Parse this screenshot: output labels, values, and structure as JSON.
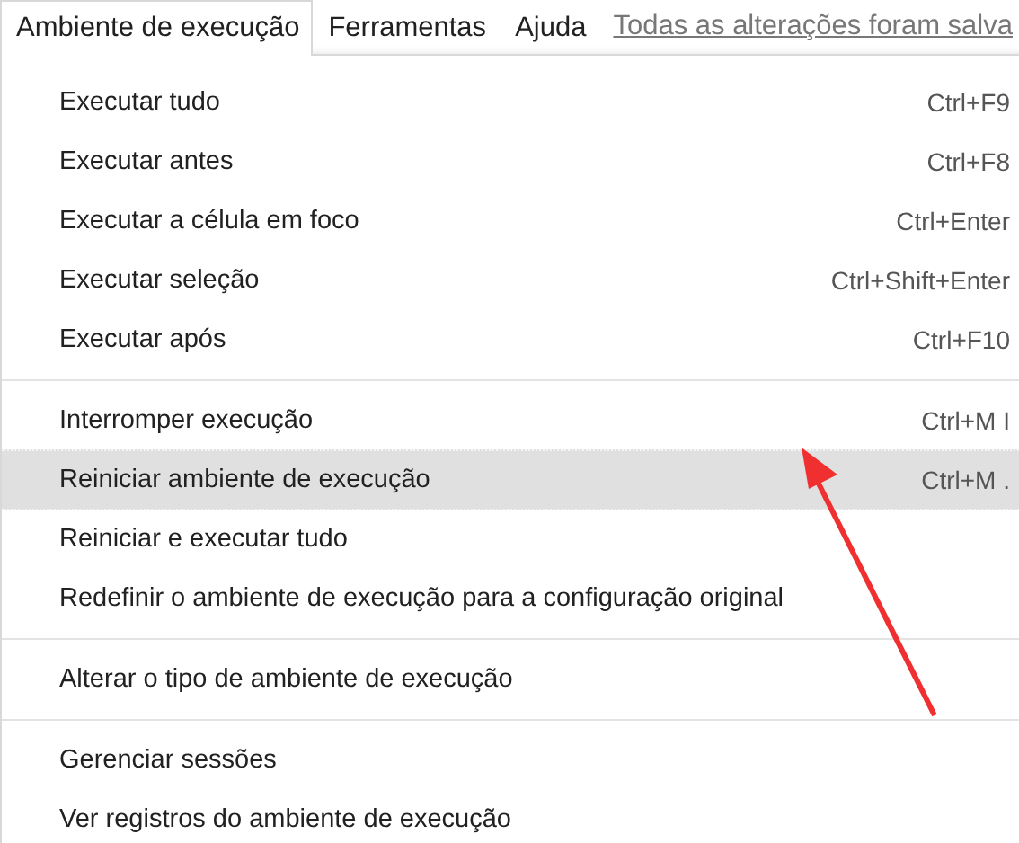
{
  "menubar": {
    "items": [
      {
        "label": "Ambiente de execução",
        "selected": true
      },
      {
        "label": "Ferramentas",
        "selected": false
      },
      {
        "label": "Ajuda",
        "selected": false
      }
    ],
    "status_link": "Todas as alterações foram salva"
  },
  "menu": {
    "groups": [
      [
        {
          "label": "Executar tudo",
          "shortcut": "Ctrl+F9",
          "highlighted": false
        },
        {
          "label": "Executar antes",
          "shortcut": "Ctrl+F8",
          "highlighted": false
        },
        {
          "label": "Executar a célula em foco",
          "shortcut": "Ctrl+Enter",
          "highlighted": false
        },
        {
          "label": "Executar seleção",
          "shortcut": "Ctrl+Shift+Enter",
          "highlighted": false
        },
        {
          "label": "Executar após",
          "shortcut": "Ctrl+F10",
          "highlighted": false
        }
      ],
      [
        {
          "label": "Interromper execução",
          "shortcut": "Ctrl+M I",
          "highlighted": false
        },
        {
          "label": "Reiniciar ambiente de execução",
          "shortcut": "Ctrl+M .",
          "highlighted": true
        },
        {
          "label": "Reiniciar e executar tudo",
          "highlighted": false
        },
        {
          "label": "Redefinir o ambiente de execução para a configuração original",
          "highlighted": false
        }
      ],
      [
        {
          "label": "Alterar o tipo de ambiente de execução",
          "highlighted": false
        }
      ],
      [
        {
          "label": "Gerenciar sessões",
          "highlighted": false
        },
        {
          "label": "Ver registros do ambiente de execução",
          "highlighted": false
        }
      ]
    ]
  }
}
